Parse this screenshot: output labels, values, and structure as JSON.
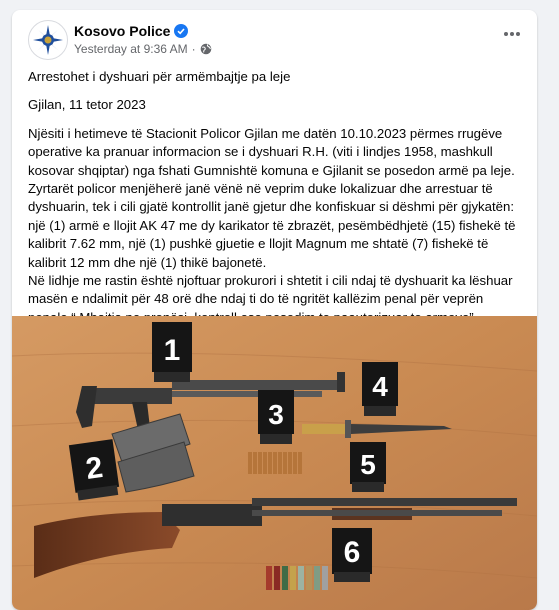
{
  "post": {
    "author": "Kosovo Police",
    "timestamp": "Yesterday at 9:36 AM",
    "audience_separator": "·",
    "title": "Arrestohet i dyshuari për armëmbajtje pa leje",
    "dateline": "Gjilan, 11 tetor 2023",
    "body_lines": [
      "Njësiti i hetimeve të Stacionit Policor Gjilan me datën 10.10.2023 përmes rrugëve",
      "operative ka pranuar informacion se i dyshuari R.H. (viti i lindjes 1958, mashkull",
      "kosovar shqiptar) nga fshati Gumnishtë komuna e Gjilanit se posedon armë pa leje.",
      "Zyrtarët policor menjëherë janë vënë në veprim duke lokalizuar dhe arrestuar të",
      "dyshuarin, tek i cili gjatë kontrollit janë gjetur dhe konfiskuar si dëshmi për gjykatën:",
      "një (1) armë e llojit AK 47 me dy karikator të zbrazët, pesëmbëdhjetë (15) fishekë të",
      "kalibrit 7.62 mm, një (1) pushkë gjuetie e llojit Magnum me shtatë (7) fishekë të",
      "kalibrit 12 mm dhe një (1) thikë bajonetë.",
      "Në lidhje me rastin është njoftuar prokurori i shtetit i cili ndaj të dyshuarit ka lëshuar",
      "masën e ndalimit për 48 orë dhe ndaj ti do të ngritët kallëzim penal për veprën",
      "penale “ Mbajtja ne pronësi, kontroll ose posedim te paautorizuar te armeve”."
    ],
    "evidence_markers": [
      "1",
      "2",
      "3",
      "4",
      "5",
      "6"
    ]
  },
  "icons": {
    "avatar": "police-badge-icon",
    "verified": "verified-badge-icon",
    "audience": "globe-icon",
    "menu": "more-options-icon"
  },
  "colors": {
    "background": "#f0f2f5",
    "card": "#ffffff",
    "text": "#050505",
    "secondary_text": "#65676b",
    "verified_blue": "#1877f2"
  }
}
